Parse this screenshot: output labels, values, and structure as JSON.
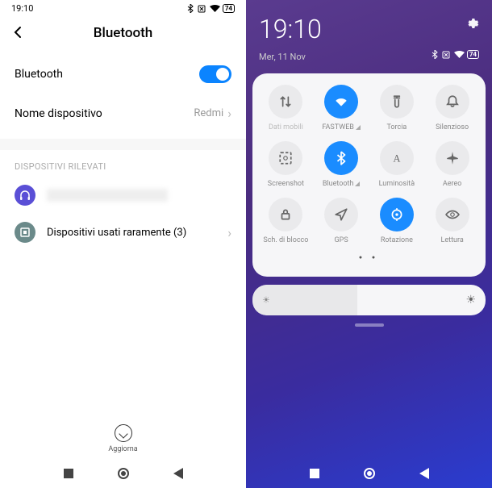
{
  "left": {
    "status_time": "19:10",
    "battery": "74",
    "header_title": "Bluetooth",
    "bluetooth_label": "Bluetooth",
    "device_name_label": "Nome dispositivo",
    "device_name_value": "Redmi",
    "detected_header": "DISPOSITIVI RILEVATI",
    "rare_devices_label": "Dispositivi usati raramente (3)",
    "refresh_label": "Aggiorna"
  },
  "right": {
    "time": "19:10",
    "date": "Mer, 11 Nov",
    "battery": "74",
    "tiles": [
      {
        "label": "Dati mobili",
        "active": false,
        "dimmed": true,
        "icon": "data"
      },
      {
        "label": "FASTWEB",
        "active": true,
        "icon": "wifi",
        "signal": true
      },
      {
        "label": "Torcia",
        "active": false,
        "icon": "torch"
      },
      {
        "label": "Silenzioso",
        "active": false,
        "icon": "bell"
      },
      {
        "label": "Screenshot",
        "active": false,
        "icon": "screenshot"
      },
      {
        "label": "Bluetooth",
        "active": true,
        "icon": "bluetooth",
        "signal": true
      },
      {
        "label": "Luminosità",
        "active": false,
        "icon": "brightness"
      },
      {
        "label": "Aereo",
        "active": false,
        "icon": "airplane"
      },
      {
        "label": "Sch. di blocco",
        "active": false,
        "icon": "lock"
      },
      {
        "label": "GPS",
        "active": false,
        "icon": "gps"
      },
      {
        "label": "Rotazione",
        "active": true,
        "icon": "rotation"
      },
      {
        "label": "Lettura",
        "active": false,
        "icon": "eye"
      }
    ]
  }
}
